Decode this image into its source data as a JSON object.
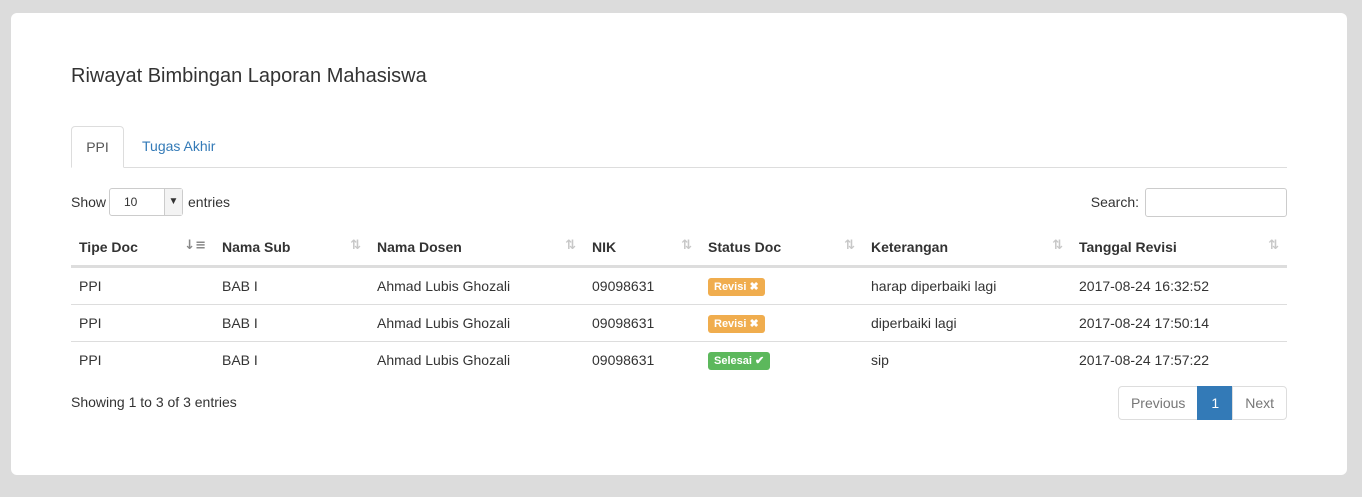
{
  "page": {
    "title": "Riwayat Bimbingan Laporan Mahasiswa"
  },
  "tabs": [
    {
      "label": "PPI",
      "active": true
    },
    {
      "label": "Tugas Akhir",
      "active": false
    }
  ],
  "length_control": {
    "before": "Show",
    "value": "10",
    "after": "entries"
  },
  "search": {
    "label": "Search:",
    "value": ""
  },
  "table": {
    "columns": [
      "Tipe Doc",
      "Nama Sub",
      "Nama Dosen",
      "NIK",
      "Status Doc",
      "Keterangan",
      "Tanggal Revisi"
    ],
    "sorted_column": 0,
    "rows": [
      {
        "tipe": "PPI",
        "sub": "BAB I",
        "dosen": "Ahmad Lubis Ghozali",
        "nik": "09098631",
        "status": "Revisi",
        "status_icon": "✖",
        "status_color": "#f0ad4e",
        "keterangan": "harap diperbaiki lagi",
        "tanggal": "2017-08-24 16:32:52"
      },
      {
        "tipe": "PPI",
        "sub": "BAB I",
        "dosen": "Ahmad Lubis Ghozali",
        "nik": "09098631",
        "status": "Revisi",
        "status_icon": "✖",
        "status_color": "#f0ad4e",
        "keterangan": "diperbaiki lagi",
        "tanggal": "2017-08-24 17:50:14"
      },
      {
        "tipe": "PPI",
        "sub": "BAB I",
        "dosen": "Ahmad Lubis Ghozali",
        "nik": "09098631",
        "status": "Selesai",
        "status_icon": "✔",
        "status_color": "#5cb85c",
        "keterangan": "sip",
        "tanggal": "2017-08-24 17:57:22"
      }
    ]
  },
  "footer": {
    "info": "Showing 1 to 3 of 3 entries",
    "previous": "Previous",
    "current_page": "1",
    "next": "Next"
  },
  "colors": {
    "link": "#337ab7",
    "revisi": "#f0ad4e",
    "selesai": "#5cb85c"
  },
  "icons": {
    "sort_asc": "sort-ascending-icon",
    "sort_both": "sort-both-icon"
  }
}
